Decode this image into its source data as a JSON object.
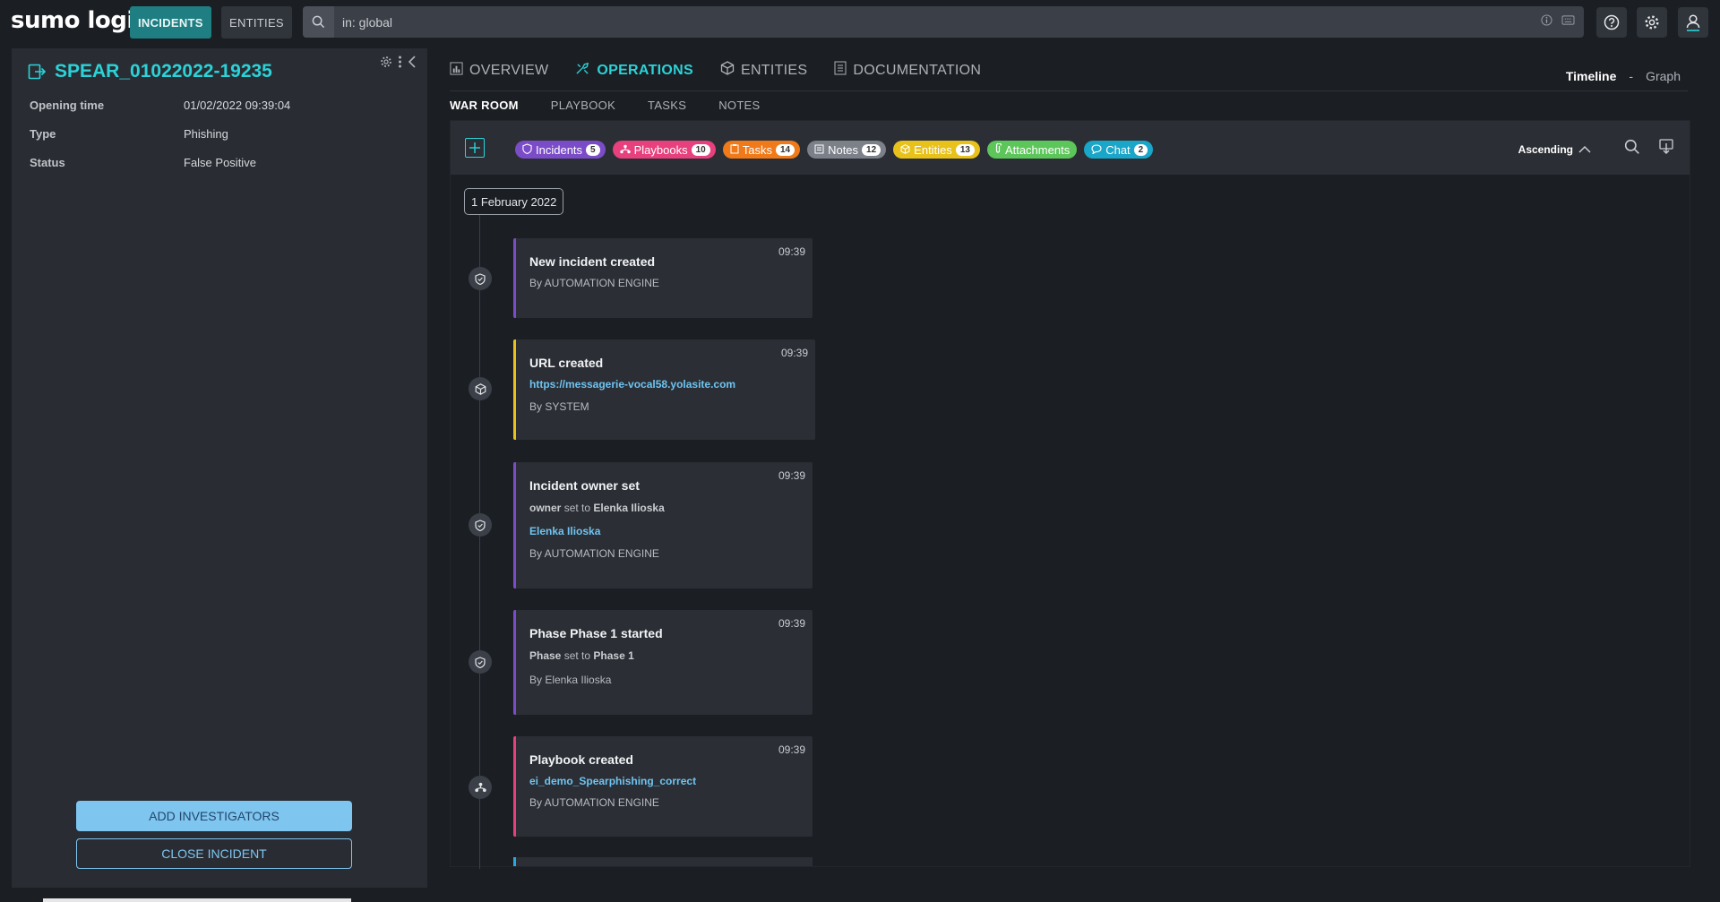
{
  "topbar": {
    "logo": "sumo logic",
    "nav": [
      {
        "label": "INCIDENTS",
        "active": true
      },
      {
        "label": "ENTITIES",
        "active": false
      }
    ],
    "search": {
      "value": "in: global",
      "placeholder": ""
    },
    "icons": [
      "help-icon",
      "settings-icon",
      "user-icon"
    ]
  },
  "incident": {
    "title": "SPEAR_01022022-19235",
    "fields": [
      {
        "key": "Opening time",
        "value": "01/02/2022 09:39:04"
      },
      {
        "key": "Type",
        "value": "Phishing"
      },
      {
        "key": "Status",
        "value": "False Positive"
      }
    ],
    "actions": {
      "add_investigators": "ADD INVESTIGATORS",
      "close_incident": "CLOSE INCIDENT"
    }
  },
  "main": {
    "tabs": [
      {
        "label": "OVERVIEW",
        "icon": "chart-icon",
        "active": false
      },
      {
        "label": "OPERATIONS",
        "icon": "tools-icon",
        "active": true
      },
      {
        "label": "ENTITIES",
        "icon": "cube-icon",
        "active": false
      },
      {
        "label": "DOCUMENTATION",
        "icon": "document-icon",
        "active": false
      }
    ],
    "view_toggle": {
      "timeline": "Timeline",
      "separator": "-",
      "graph": "Graph"
    },
    "subtabs": [
      {
        "label": "WAR ROOM",
        "active": true
      },
      {
        "label": "PLAYBOOK",
        "active": false
      },
      {
        "label": "TASKS",
        "active": false
      },
      {
        "label": "NOTES",
        "active": false
      }
    ]
  },
  "filters": {
    "chips": [
      {
        "label": "Incidents",
        "count": "5",
        "color": "#7b4cc7"
      },
      {
        "label": "Playbooks",
        "count": "10",
        "color": "#e83f7d"
      },
      {
        "label": "Tasks",
        "count": "14",
        "color": "#f07a1a"
      },
      {
        "label": "Notes",
        "count": "12",
        "color": "#7b8089"
      },
      {
        "label": "Entities",
        "count": "13",
        "color": "#e8c21a"
      },
      {
        "label": "Attachments",
        "count": "",
        "color": "#5cc65a"
      },
      {
        "label": "Chat",
        "count": "2",
        "color": "#1aa6c8"
      }
    ],
    "sort": "Ascending"
  },
  "timeline": {
    "date": "1 February 2022",
    "events": [
      {
        "title": "New incident created",
        "time": "09:39",
        "by": "By AUTOMATION ENGINE",
        "icon": "shield-icon",
        "accent": "#7b4cc7"
      },
      {
        "title": "URL created",
        "time": "09:39",
        "link": "https://messagerie-vocal58.yolasite.com",
        "by": "By SYSTEM",
        "icon": "cube-icon",
        "accent": "#e8c21a"
      },
      {
        "title": "Incident owner set",
        "time": "09:39",
        "field": "owner",
        "set_to": "set to",
        "value": "Elenka Ilioska",
        "link": "Elenka Ilioska",
        "by": "By AUTOMATION ENGINE",
        "icon": "shield-icon",
        "accent": "#7b4cc7"
      },
      {
        "title": "Phase Phase 1 started",
        "time": "09:39",
        "field": "Phase",
        "set_to": "set to",
        "value": "Phase 1",
        "by": "By Elenka Ilioska",
        "icon": "shield-icon",
        "accent": "#7b4cc7"
      },
      {
        "title": "Playbook created",
        "time": "09:39",
        "link": "ei_demo_Spearphishing_correct",
        "by": "By AUTOMATION ENGINE",
        "icon": "sitemap-icon",
        "accent": "#e83f7d"
      }
    ]
  }
}
